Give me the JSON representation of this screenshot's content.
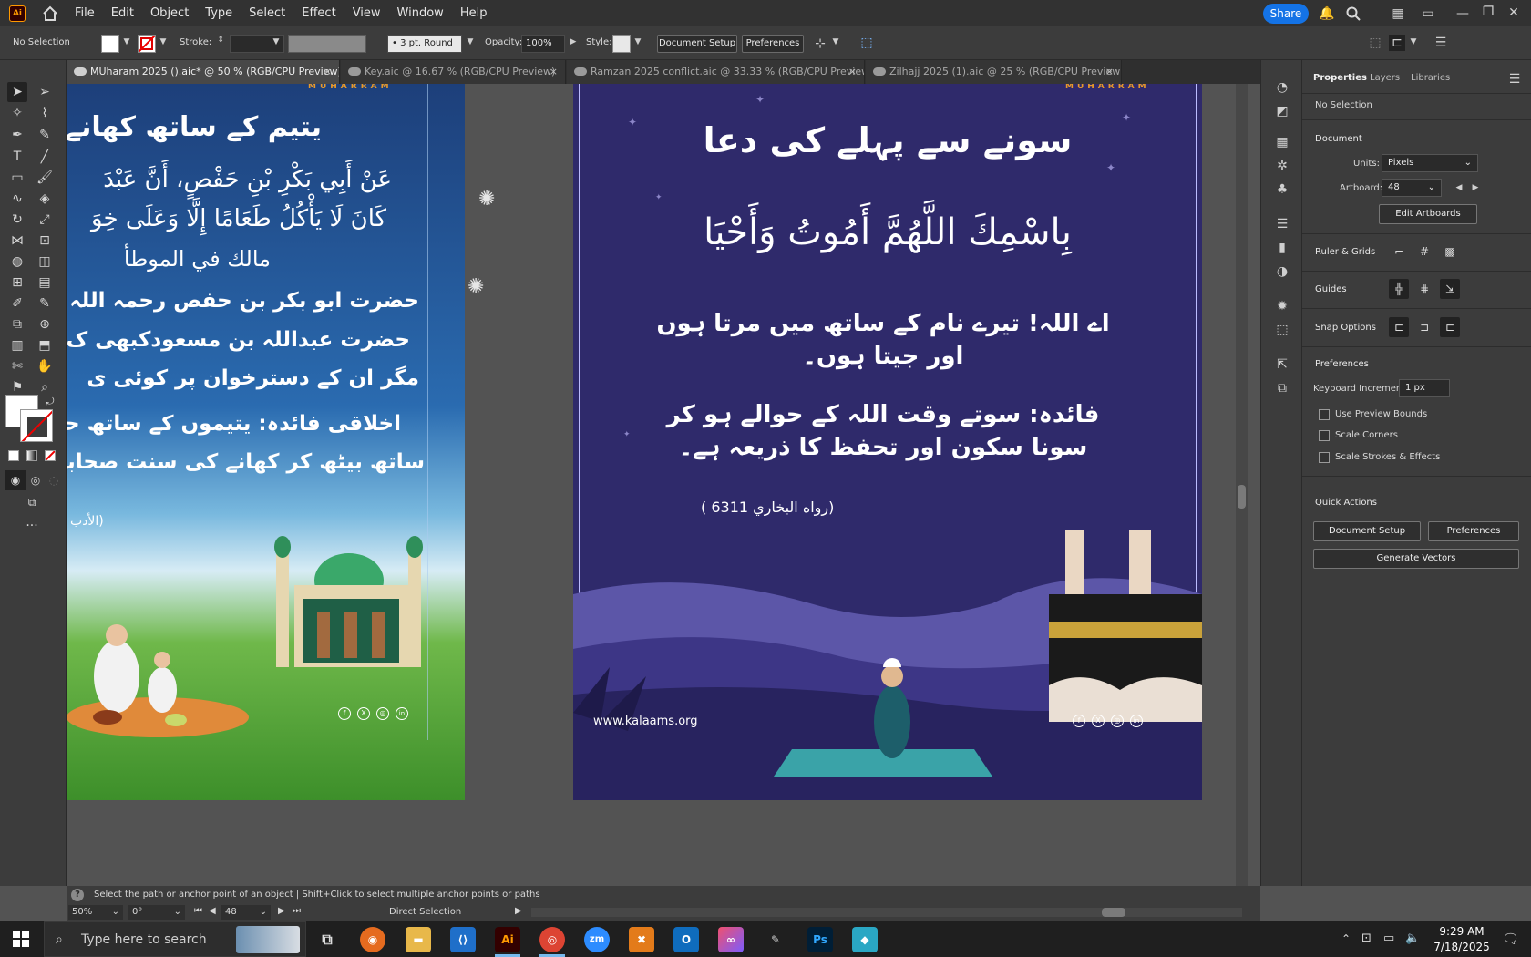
{
  "menubar": {
    "logo": "Ai",
    "items": [
      "File",
      "Edit",
      "Object",
      "Type",
      "Select",
      "Effect",
      "View",
      "Window",
      "Help"
    ],
    "share": "Share"
  },
  "controlbar": {
    "selection": "No Selection",
    "stroke_label": "Stroke:",
    "brush": "3 pt. Round",
    "opacity_label": "Opacity:",
    "opacity": "100%",
    "style_label": "Style:",
    "document_setup": "Document Setup",
    "preferences": "Preferences"
  },
  "tabs": [
    {
      "label": "MUharam 2025 ().aic* @ 50 % (RGB/CPU Preview)",
      "active": true
    },
    {
      "label": "Key.aic @ 16.67 % (RGB/CPU Preview)",
      "active": false
    },
    {
      "label": "Ramzan 2025 conflict.aic @ 33.33 % (RGB/CPU Preview)",
      "active": false
    },
    {
      "label": "Zilhajj 2025 (1).aic @ 25 % (RGB/CPU Preview)",
      "active": false
    }
  ],
  "tab_close": "×",
  "left_artboard": {
    "muharram": "MUHARRAM",
    "title": "یتیم کے ساتھ کھانے کی",
    "arabic1": "عَنْ أَبِي بَكْرِ بْنِ حَفْصٍ، أَنَّ عَبْدَ",
    "arabic2": "كَانَ لَا يَأْكُلُ طَعَامًا إِلَّا وَعَلَى خِوَ",
    "arabic3": "مالك في الموطأ",
    "urdu1": "حضرت ابو بکر بن حفص رحمہ اللہ",
    "urdu2": "حضرت عبداللہ بن مسعودکبھی ک",
    "urdu3": "مگر ان کے دسترخوان پر کوئی ی",
    "moral1": "اخلاقی فائدہ: یتیموں کے ساتھ حس",
    "moral2": "ساتھ بیٹھ کر کھانے کی سنت صحابہ",
    "ref": "(الأدب",
    "social": [
      "f",
      "X",
      "◎",
      "in"
    ]
  },
  "right_artboard": {
    "muharram": "MUHARRAM",
    "title": "سونے سے پہلے کی دعا",
    "dua": "بِاسْمِكَ اللَّهُمَّ أَمُوتُ وَأَحْيَا",
    "translation": "اے اللہ! تیرے نام کے ساتھ میں مرتا ہوں اور جیتا ہوں۔",
    "benefit": "فائدہ: سوتے وقت اللہ کے حوالے ہو کر سونا سکون اور تحفظ کا ذریعہ ہے۔",
    "reference": "(رواه البخاري 6311 )",
    "website": "www.kalaams.org",
    "social": [
      "f",
      "X",
      "◎",
      "in"
    ]
  },
  "panel": {
    "tabs": [
      "Properties",
      "Layers",
      "Libraries"
    ],
    "selection": "No Selection",
    "document_head": "Document",
    "units_label": "Units:",
    "units": "Pixels",
    "artboard_label": "Artboard:",
    "artboard": "48",
    "edit_artboards": "Edit Artboards",
    "ruler_grids": "Ruler & Grids",
    "guides": "Guides",
    "snap_options": "Snap Options",
    "preferences_head": "Preferences",
    "keyboard_increment_label": "Keyboard Increment:",
    "keyboard_increment": "1 px",
    "checks": [
      "Use Preview Bounds",
      "Scale Corners",
      "Scale Strokes & Effects"
    ],
    "quick_actions": "Quick Actions",
    "document_setup": "Document Setup",
    "preferences": "Preferences",
    "generate_vectors": "Generate Vectors"
  },
  "hint": "Select the path or anchor point of an object  |  Shift+Click to select multiple anchor points or paths",
  "status": {
    "zoom": "50%",
    "rotation": "0°",
    "artboard": "48",
    "tool": "Direct Selection"
  },
  "taskbar": {
    "search_placeholder": "Type here to search",
    "time": "9:29 AM",
    "date": "7/18/2025"
  }
}
